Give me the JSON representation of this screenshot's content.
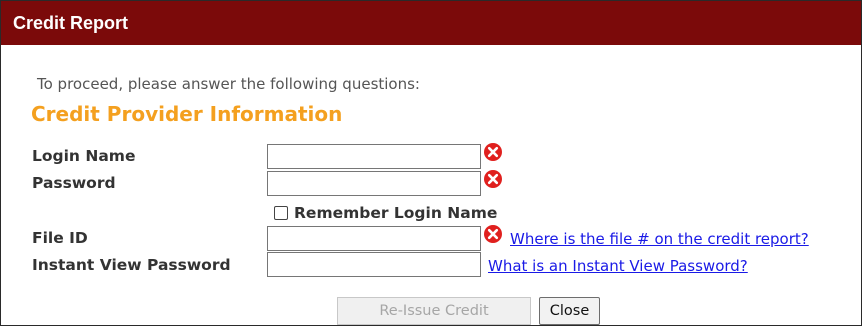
{
  "window": {
    "title": "Credit Report"
  },
  "form": {
    "prompt": "To proceed, please answer the following questions:",
    "section_title": "Credit Provider Information",
    "login_name": {
      "label": "Login Name",
      "value": ""
    },
    "password": {
      "label": "Password",
      "value": ""
    },
    "remember": {
      "label": "Remember Login Name",
      "checked": false
    },
    "file_id": {
      "label": "File ID",
      "value": ""
    },
    "instant_view_password": {
      "label": "Instant View Password",
      "value": ""
    },
    "links": {
      "file_help": "Where is the file # on the credit report?",
      "instant_view_help": "What is an Instant View Password?"
    }
  },
  "buttons": {
    "reissue": "Re-Issue Credit",
    "close": "Close"
  },
  "icons": {
    "error": "error-x-icon"
  },
  "colors": {
    "titlebar": "#7b0a0a",
    "section_title": "#f4a01f",
    "error": "#e0201e",
    "link": "#1a1ae6"
  }
}
